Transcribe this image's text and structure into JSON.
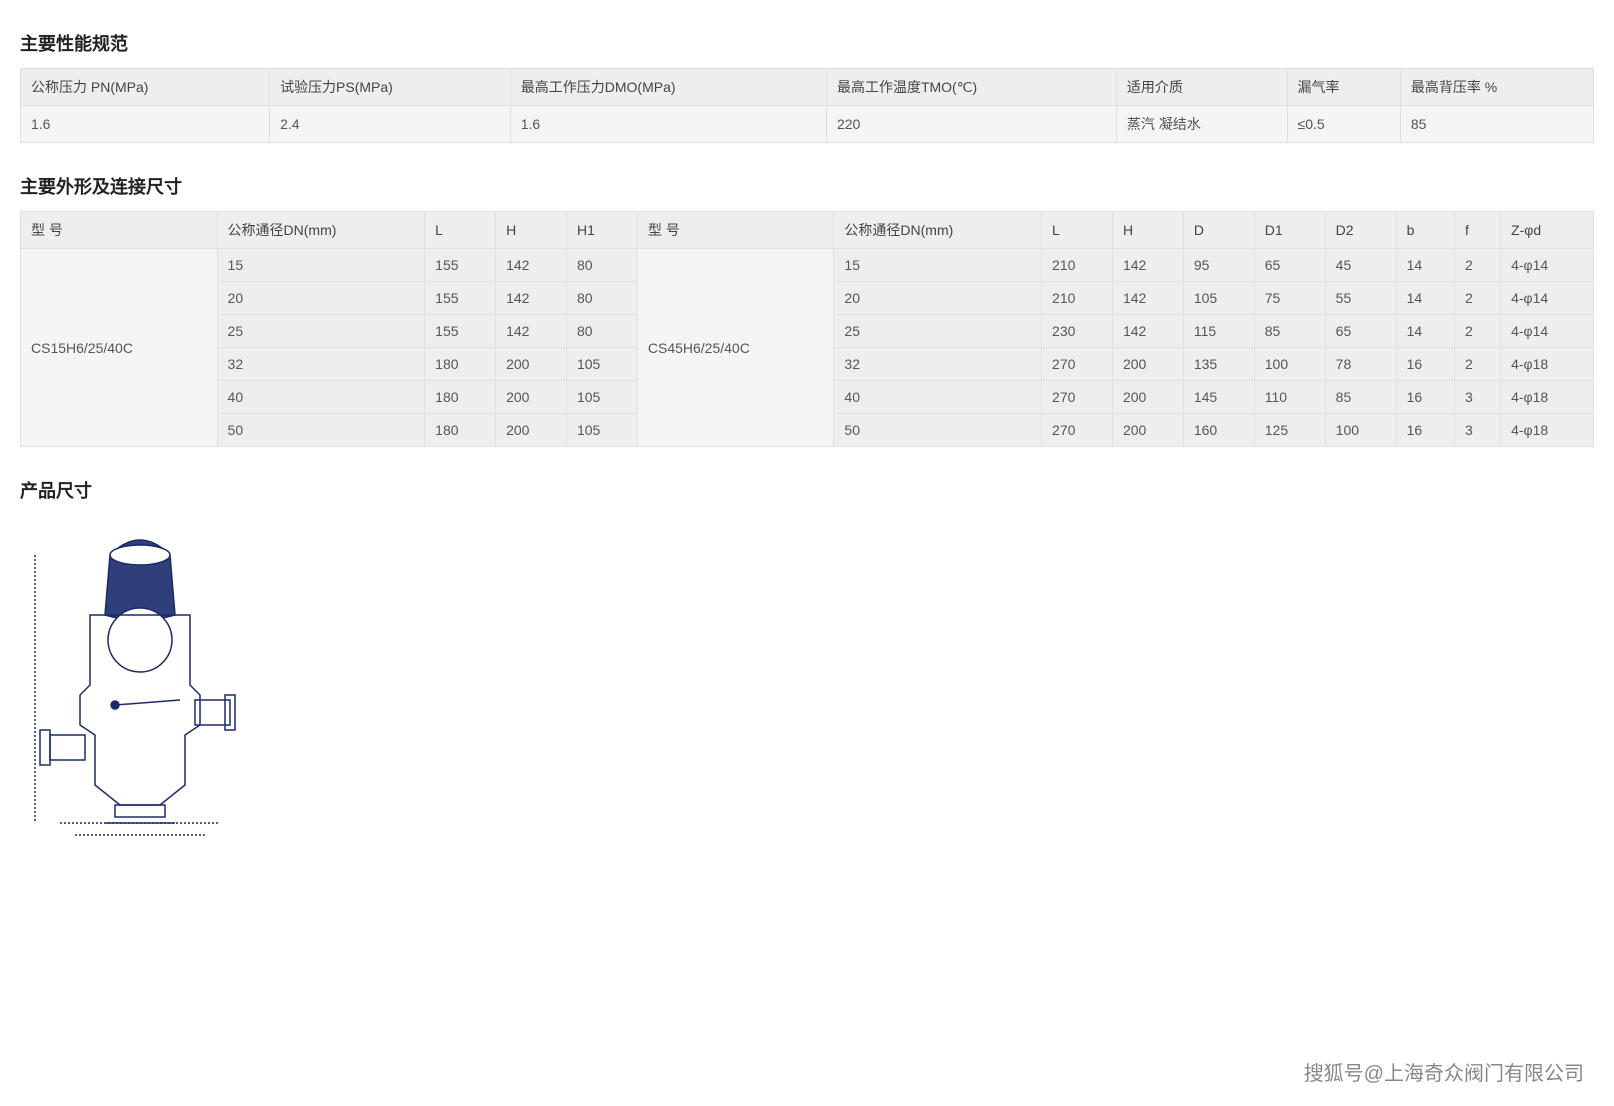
{
  "section1": {
    "title": "主要性能规范",
    "headers": [
      "公称压力 PN(MPa)",
      "试验压力PS(MPa)",
      "最高工作压力DMO(MPa)",
      "最高工作温度TMO(℃)",
      "适用介质",
      "漏气率",
      "最高背压率 %"
    ],
    "row": [
      "1.6",
      "2.4",
      "1.6",
      "220",
      "蒸汽 凝结水",
      "≤0.5",
      "85"
    ]
  },
  "section2": {
    "title": "主要外形及连接尺寸",
    "headers": [
      "型 号",
      "公称通径DN(mm)",
      "L",
      "H",
      "H1",
      "型 号",
      "公称通径DN(mm)",
      "L",
      "H",
      "D",
      "D1",
      "D2",
      "b",
      "f",
      "Z-φd"
    ],
    "model_a": "CS15H6/25/40C",
    "model_b": "CS45H6/25/40C",
    "rows": [
      {
        "a": [
          "15",
          "155",
          "142",
          "80"
        ],
        "b": [
          "15",
          "210",
          "142",
          "95",
          "65",
          "45",
          "14",
          "2",
          "4-φ14"
        ]
      },
      {
        "a": [
          "20",
          "155",
          "142",
          "80"
        ],
        "b": [
          "20",
          "210",
          "142",
          "105",
          "75",
          "55",
          "14",
          "2",
          "4-φ14"
        ]
      },
      {
        "a": [
          "25",
          "155",
          "142",
          "80"
        ],
        "b": [
          "25",
          "230",
          "142",
          "115",
          "85",
          "65",
          "14",
          "2",
          "4-φ14"
        ]
      },
      {
        "a": [
          "32",
          "180",
          "200",
          "105"
        ],
        "b": [
          "32",
          "270",
          "200",
          "135",
          "100",
          "78",
          "16",
          "2",
          "4-φ18"
        ]
      },
      {
        "a": [
          "40",
          "180",
          "200",
          "105"
        ],
        "b": [
          "40",
          "270",
          "200",
          "145",
          "110",
          "85",
          "16",
          "3",
          "4-φ18"
        ]
      },
      {
        "a": [
          "50",
          "180",
          "200",
          "105"
        ],
        "b": [
          "50",
          "270",
          "200",
          "160",
          "125",
          "100",
          "16",
          "3",
          "4-φ18"
        ]
      }
    ]
  },
  "section3": {
    "title": "产品尺寸"
  },
  "watermark": "搜狐号@上海奇众阀门有限公司"
}
